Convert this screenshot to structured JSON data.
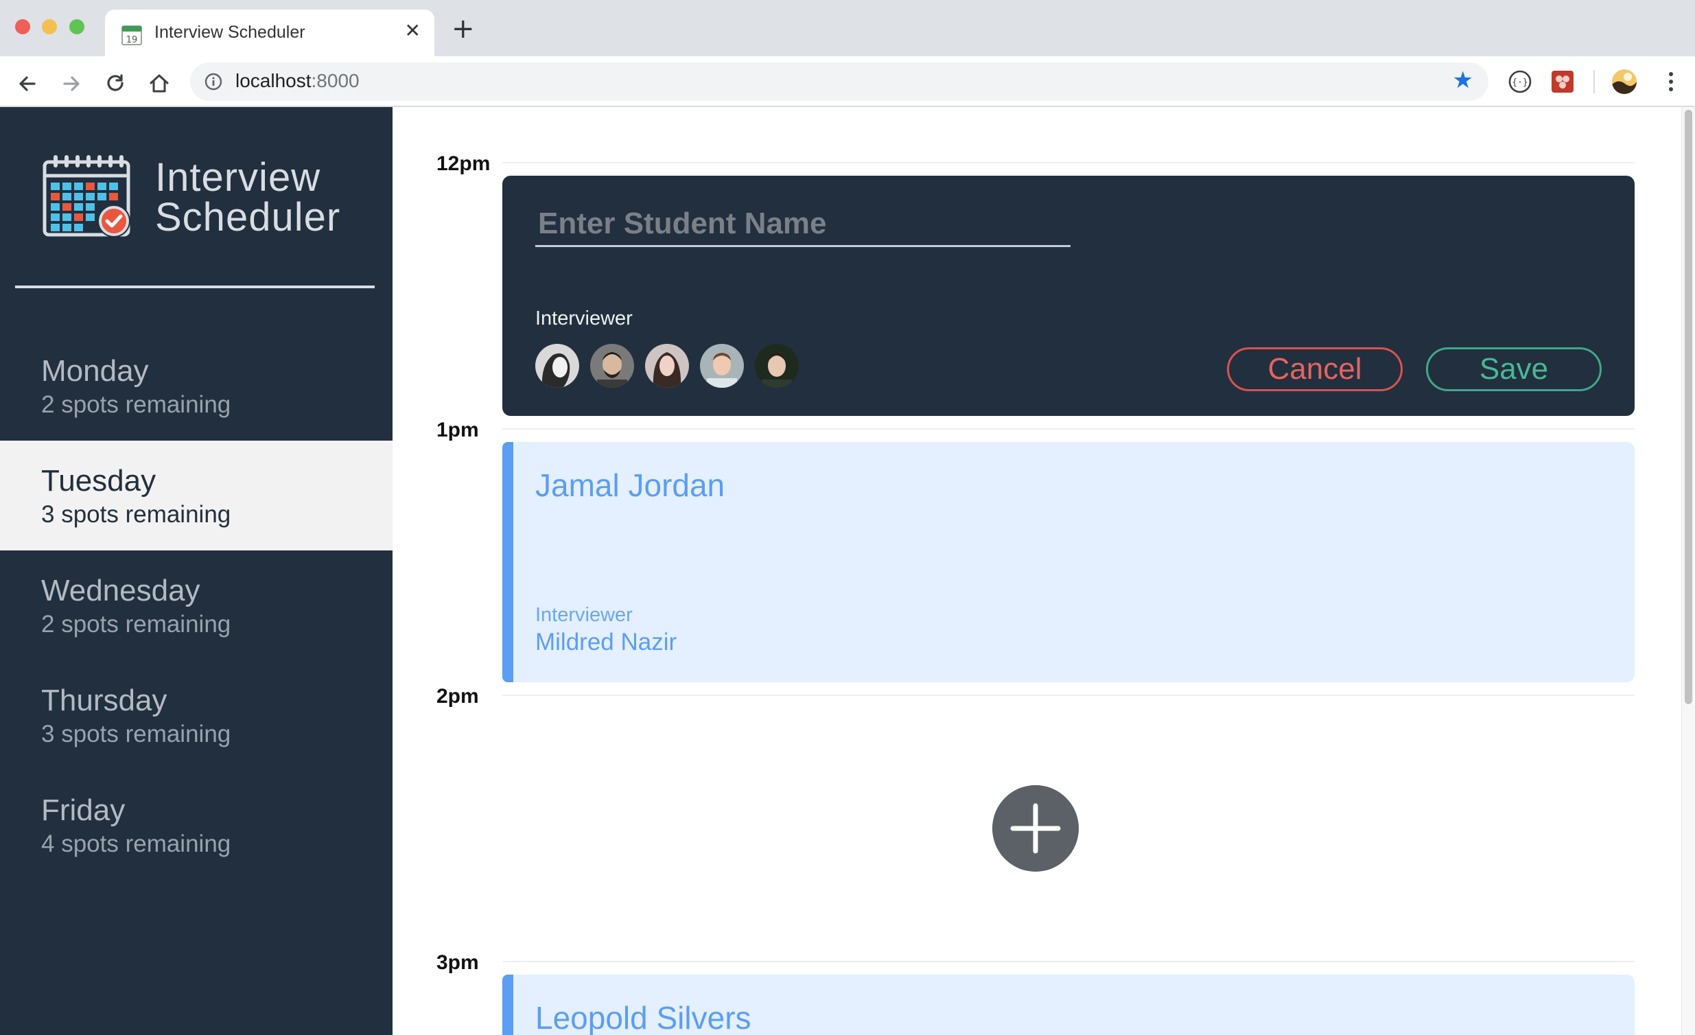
{
  "browser": {
    "tab_title": "Interview Scheduler",
    "tab_close": "✕",
    "new_tab": "+",
    "url_host": "localhost",
    "url_port": ":8000",
    "favicon_day": "19"
  },
  "sidebar": {
    "brand_line1": "Interview",
    "brand_line2": "Scheduler",
    "days": [
      {
        "name": "Monday",
        "spots": "2 spots remaining",
        "selected": false
      },
      {
        "name": "Tuesday",
        "spots": "3 spots remaining",
        "selected": true
      },
      {
        "name": "Wednesday",
        "spots": "2 spots remaining",
        "selected": false
      },
      {
        "name": "Thursday",
        "spots": "3 spots remaining",
        "selected": false
      },
      {
        "name": "Friday",
        "spots": "4 spots remaining",
        "selected": false
      }
    ]
  },
  "schedule": {
    "times": [
      "12pm",
      "1pm",
      "2pm",
      "3pm"
    ],
    "form": {
      "placeholder": "Enter Student Name",
      "interviewer_label": "Interviewer",
      "cancel_label": "Cancel",
      "save_label": "Save"
    },
    "appointments": [
      {
        "student": "Jamal Jordan",
        "interviewer_label": "Interviewer",
        "interviewer": "Mildred Nazir"
      },
      {
        "student": "Leopold Silvers"
      }
    ]
  },
  "colors": {
    "sidebar_bg": "#222f3e",
    "selected_day_bg": "#f2f2f2",
    "booked_bg": "#e4efff",
    "booked_accent": "#5b9ef2",
    "cancel": "#d9534f",
    "save": "#3fa98a",
    "add_button": "#5c6167"
  }
}
